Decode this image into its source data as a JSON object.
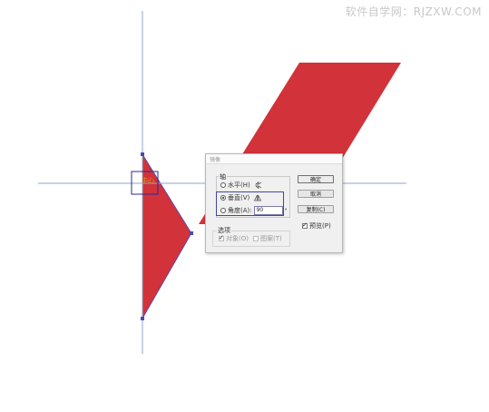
{
  "watermark": "软件自学网：RJZXW.COM",
  "canvas": {
    "anchor_label": "中心",
    "shape_color": "#d2323a",
    "guide_color": "#8fa6c8",
    "selection_color": "#2a2a9a"
  },
  "dialog": {
    "title": "镜像",
    "axis_group": {
      "label": "轴",
      "horizontal": {
        "label": "水平(H)",
        "checked": false
      },
      "vertical": {
        "label": "垂直(V)",
        "checked": true
      },
      "angle": {
        "label": "角度(A):",
        "value": "90",
        "unit": "°",
        "checked": false
      }
    },
    "options_group": {
      "label": "选项",
      "objects": {
        "label": "对象(O)",
        "checked": true,
        "disabled": true
      },
      "patterns": {
        "label": "图案(T)",
        "checked": false,
        "disabled": true
      }
    },
    "buttons": {
      "ok": "确定",
      "cancel": "取消",
      "copy": "复制(C)"
    },
    "preview": {
      "label": "预览(P)",
      "checked": true
    }
  }
}
